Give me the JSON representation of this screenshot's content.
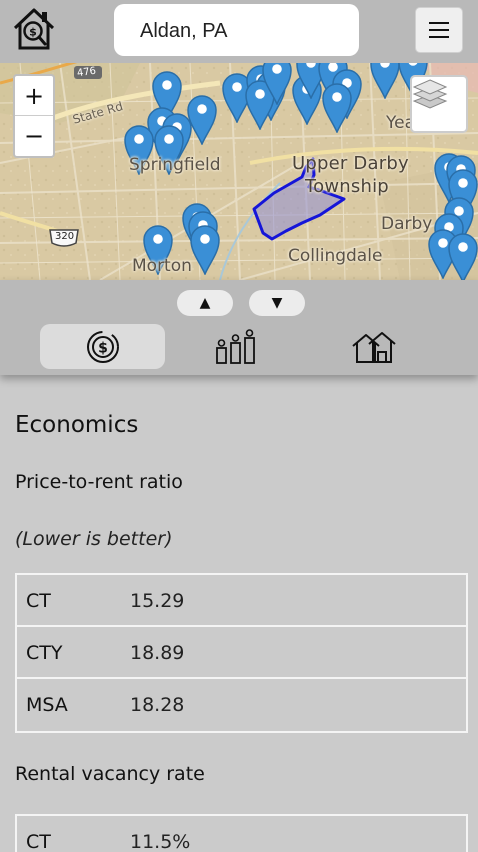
{
  "header": {
    "logo_icon": "house-dollar-magnifier-icon",
    "location": "Aldan, PA",
    "menu_icon": "hamburger-menu-icon"
  },
  "map": {
    "zoom_in_label": "+",
    "zoom_out_label": "−",
    "layers_icon": "layers-icon",
    "place_labels": [
      "Springfield",
      "Upper Darby",
      "Township",
      "Darby",
      "Collingdale",
      "Morton",
      "Yea",
      "State Rd"
    ],
    "road_shields": [
      "476",
      "320"
    ],
    "marker_color": "#3a8fd6",
    "boundary_color": "#1515d8"
  },
  "panel": {
    "up_label": "▲",
    "down_label": "▼",
    "tabs": [
      {
        "name": "economics",
        "icon": "dollar-coin-icon",
        "selected": true
      },
      {
        "name": "demographics",
        "icon": "population-bars-icon",
        "selected": false
      },
      {
        "name": "housing",
        "icon": "houses-icon",
        "selected": false
      }
    ]
  },
  "content": {
    "section_title": "Economics",
    "metrics": [
      {
        "title": "Price-to-rent ratio",
        "note": "(Lower is better)",
        "rows": [
          {
            "label": "CT",
            "value": "15.29"
          },
          {
            "label": "CTY",
            "value": "18.89"
          },
          {
            "label": "MSA",
            "value": "18.28"
          }
        ]
      },
      {
        "title": "Rental vacancy rate",
        "rows": [
          {
            "label": "CT",
            "value": "11.5%"
          }
        ]
      }
    ]
  }
}
